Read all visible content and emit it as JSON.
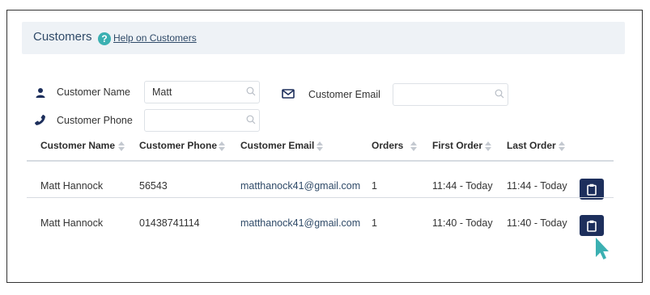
{
  "header": {
    "title": "Customers",
    "help_link": "Help on Customers"
  },
  "filters": {
    "name_label": "Customer Name",
    "name_value": "Matt",
    "phone_label": "Customer Phone",
    "phone_value": "",
    "email_label": "Customer Email",
    "email_value": ""
  },
  "table": {
    "columns": [
      "Customer Name",
      "Customer Phone",
      "Customer Email",
      "Orders",
      "First Order",
      "Last Order"
    ],
    "rows": [
      {
        "name": "Matt Hannock",
        "phone": "56543",
        "email": "matthanock41@gmail.com",
        "orders": "1",
        "first_order": "11:44 - Today",
        "last_order": "11:44 - Today"
      },
      {
        "name": "Matt Hannock",
        "phone": "01438741114",
        "email": "matthanock41@gmail.com",
        "orders": "1",
        "first_order": "11:40 - Today",
        "last_order": "11:40 - Today"
      }
    ]
  },
  "colors": {
    "accent": "#3bb0b2",
    "button": "#1d2f5c",
    "header_bg": "#eef2f6",
    "link": "#2f4a68"
  },
  "icons": {
    "help": "question-circle-icon",
    "user": "user-icon",
    "phone": "phone-icon",
    "email": "envelope-icon",
    "search": "search-icon",
    "sort": "sort-icon",
    "action": "clipboard-icon",
    "cursor": "pointer-cursor-icon"
  }
}
